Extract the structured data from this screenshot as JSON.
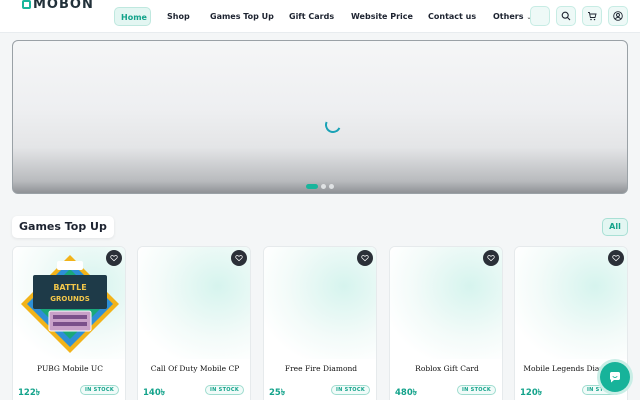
{
  "brand": {
    "logo_text": "MOBON"
  },
  "nav": {
    "items": [
      {
        "label": "Home"
      },
      {
        "label": "Shop"
      },
      {
        "label": "Games Top Up"
      },
      {
        "label": "Gift Cards"
      },
      {
        "label": "Website Price"
      },
      {
        "label": "Contact us"
      },
      {
        "label": "Others"
      }
    ],
    "chevron": "⌄",
    "icons": [
      "blank-icon",
      "search-icon",
      "cart-icon",
      "user-icon"
    ]
  },
  "hero": {
    "slides": 3,
    "active_slide": 1
  },
  "section": {
    "title": "Games Top Up",
    "all_label": "All"
  },
  "products": [
    {
      "name": "PUBG Mobile UC",
      "price": "122৳",
      "stock": "IN STOCK"
    },
    {
      "name": "Call Of Duty Mobile CP",
      "price": "140৳",
      "stock": "IN STOCK"
    },
    {
      "name": "Free Fire Diamond",
      "price": "25৳",
      "stock": "IN STOCK"
    },
    {
      "name": "Roblox Gift Card",
      "price": "480৳",
      "stock": "IN STOCK"
    },
    {
      "name": "Mobile Legends Diamond",
      "price": "120৳",
      "stock": "IN STOCK"
    }
  ],
  "colors": {
    "accent": "#19b59c",
    "dark": "#1d2330"
  }
}
